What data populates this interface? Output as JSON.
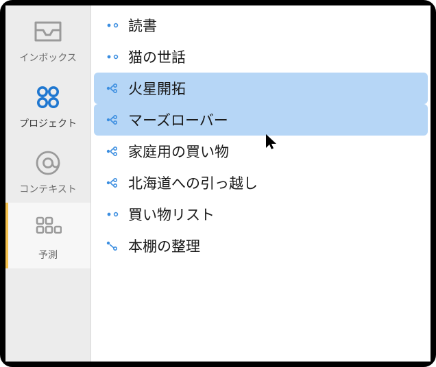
{
  "sidebar": {
    "items": [
      {
        "id": "inbox",
        "label": "インボックス"
      },
      {
        "id": "projects",
        "label": "プロジェクト"
      },
      {
        "id": "contexts",
        "label": "コンテキスト"
      },
      {
        "id": "forecast",
        "label": "予測"
      }
    ],
    "active_index": 1
  },
  "projects": {
    "items": [
      {
        "label": "読書",
        "icon": "single",
        "selected": false
      },
      {
        "label": "猫の世話",
        "icon": "single",
        "selected": false
      },
      {
        "label": "火星開拓",
        "icon": "parallel",
        "selected": true
      },
      {
        "label": "マーズローバー",
        "icon": "parallel",
        "selected": true
      },
      {
        "label": "家庭用の買い物",
        "icon": "parallel",
        "selected": false
      },
      {
        "label": "北海道への引っ越し",
        "icon": "parallel",
        "selected": false
      },
      {
        "label": "買い物リスト",
        "icon": "single",
        "selected": false
      },
      {
        "label": "本棚の整理",
        "icon": "sequential",
        "selected": false
      }
    ]
  },
  "colors": {
    "sidebar_icon": "#8e8e8e",
    "sidebar_icon_active": "#1f77d0",
    "project_icon": "#3a8de0"
  }
}
